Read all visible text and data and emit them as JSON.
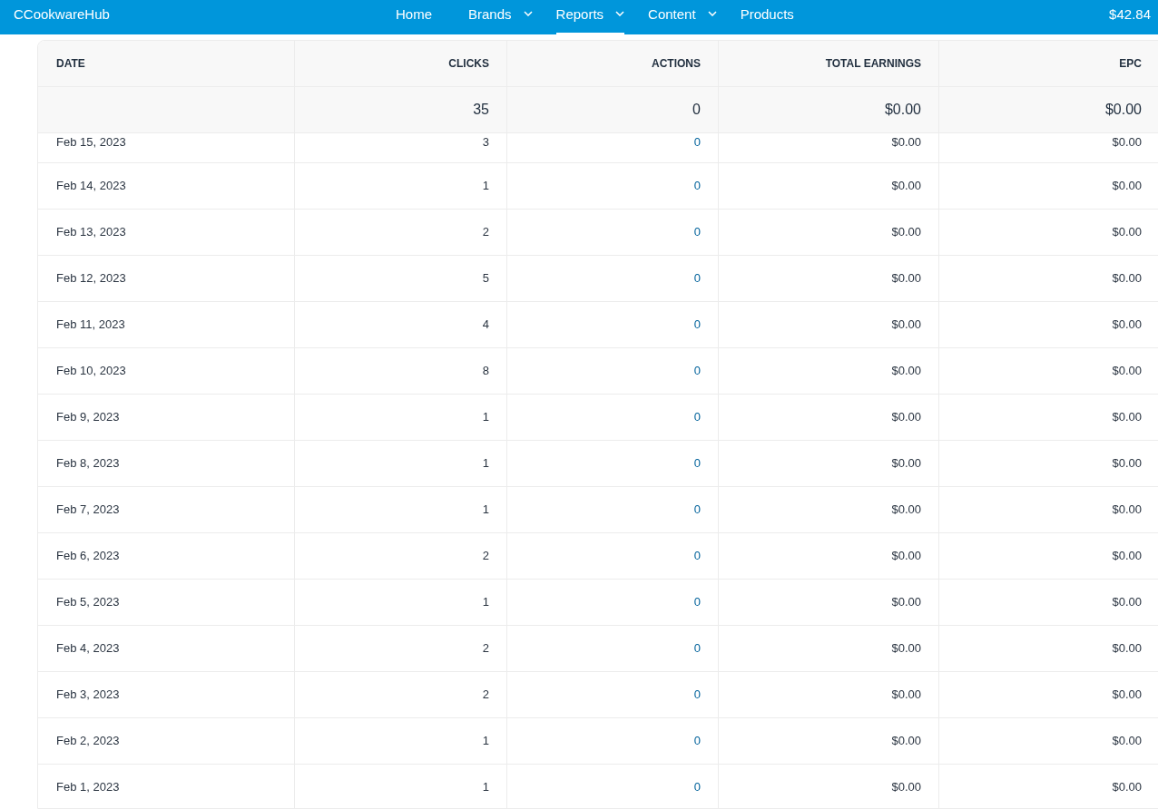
{
  "nav": {
    "brand": "CCookwareHub",
    "items": [
      {
        "label": "Home",
        "dropdown": false,
        "selected": false
      },
      {
        "label": "Brands",
        "dropdown": true,
        "selected": false
      },
      {
        "label": "Reports",
        "dropdown": true,
        "selected": true
      },
      {
        "label": "Content",
        "dropdown": true,
        "selected": false
      },
      {
        "label": "Products",
        "dropdown": false,
        "selected": false
      }
    ],
    "balance": "$42.84"
  },
  "table": {
    "columns": [
      "DATE",
      "CLICKS",
      "ACTIONS",
      "TOTAL EARNINGS",
      "EPC"
    ],
    "totals": [
      "35",
      "0",
      "$0.00",
      "$0.00"
    ],
    "rows": [
      [
        "Feb 15, 2023",
        "3",
        "0",
        "$0.00",
        "$0.00"
      ],
      [
        "Feb 14, 2023",
        "1",
        "0",
        "$0.00",
        "$0.00"
      ],
      [
        "Feb 13, 2023",
        "2",
        "0",
        "$0.00",
        "$0.00"
      ],
      [
        "Feb 12, 2023",
        "5",
        "0",
        "$0.00",
        "$0.00"
      ],
      [
        "Feb 11, 2023",
        "4",
        "0",
        "$0.00",
        "$0.00"
      ],
      [
        "Feb 10, 2023",
        "8",
        "0",
        "$0.00",
        "$0.00"
      ],
      [
        "Feb 9, 2023",
        "1",
        "0",
        "$0.00",
        "$0.00"
      ],
      [
        "Feb 8, 2023",
        "1",
        "0",
        "$0.00",
        "$0.00"
      ],
      [
        "Feb 7, 2023",
        "1",
        "0",
        "$0.00",
        "$0.00"
      ],
      [
        "Feb 6, 2023",
        "2",
        "0",
        "$0.00",
        "$0.00"
      ],
      [
        "Feb 5, 2023",
        "1",
        "0",
        "$0.00",
        "$0.00"
      ],
      [
        "Feb 4, 2023",
        "2",
        "0",
        "$0.00",
        "$0.00"
      ],
      [
        "Feb 3, 2023",
        "2",
        "0",
        "$0.00",
        "$0.00"
      ],
      [
        "Feb 2, 2023",
        "1",
        "0",
        "$0.00",
        "$0.00"
      ],
      [
        "Feb 1, 2023",
        "1",
        "0",
        "$0.00",
        "$0.00"
      ]
    ]
  }
}
